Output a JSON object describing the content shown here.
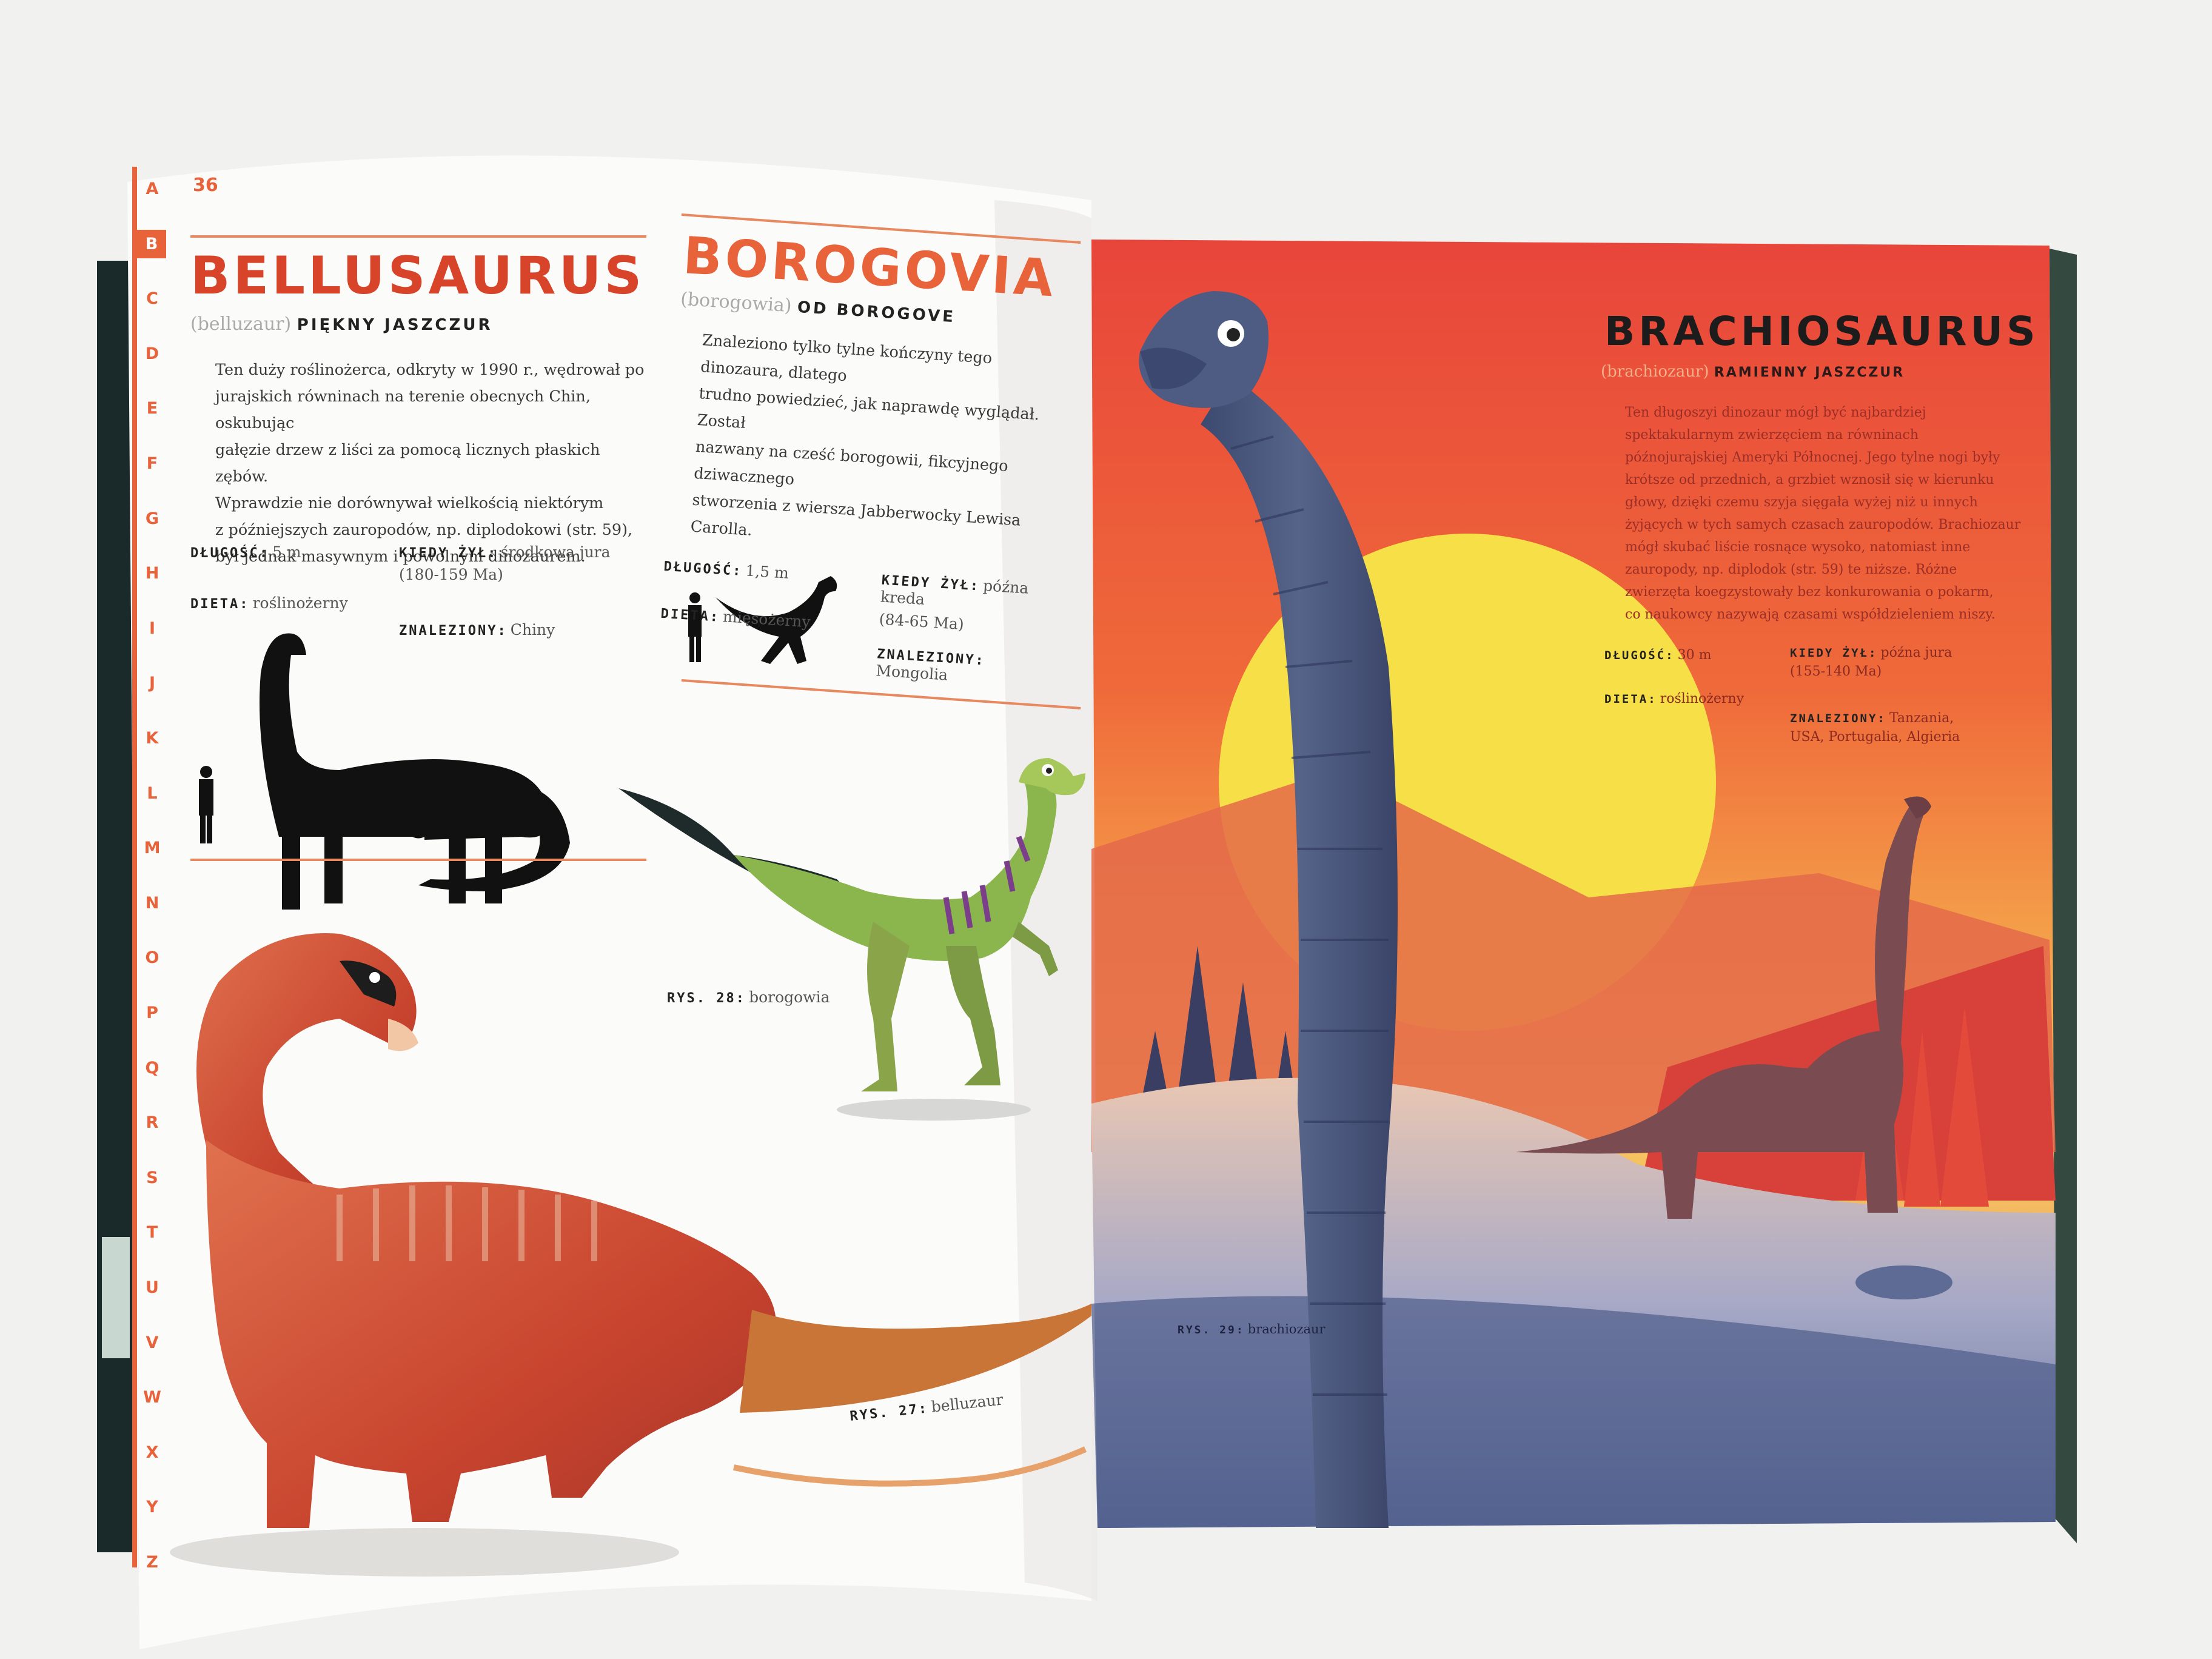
{
  "page_number": "36",
  "alphabet": [
    "A",
    "B",
    "C",
    "D",
    "E",
    "F",
    "G",
    "H",
    "I",
    "J",
    "K",
    "L",
    "M",
    "N",
    "O",
    "P",
    "Q",
    "R",
    "S",
    "T",
    "U",
    "V",
    "W",
    "X",
    "Y",
    "Z"
  ],
  "active_letter": "B",
  "bellusaurus": {
    "title": "BELLUSAURUS",
    "pronunciation": "(belluzaur)",
    "meaning": "PIĘKNY JASZCZUR",
    "body": [
      "Ten duży roślinożerca, odkryty w 1990 r., wędrował po",
      "jurajskich równinach na terenie obecnych Chin, oskubując",
      "gałęzie drzew z liści za pomocą licznych płaskich zębów.",
      "Wprawdzie nie dorównywał wielkością niektórym",
      "z późniejszych zauropodów, np. diplodokowi (str. 59),",
      "był jednak masywnym i powolnym dinozaurem."
    ],
    "length_label": "DŁUGOŚĆ:",
    "length_value": "5 m",
    "when_label": "KIEDY ŻYŁ:",
    "when_value": "środkowa jura",
    "when_range": "(180-159 Ma)",
    "diet_label": "DIETA:",
    "diet_value": "roślinożerny",
    "found_label": "ZNALEZIONY:",
    "found_value": "Chiny",
    "caption_label": "RYS. 27:",
    "caption_value": "belluzaur"
  },
  "borogovia": {
    "title": "BOROGOVIA",
    "pronunciation": "(borogowia)",
    "meaning": "OD BOROGOVE",
    "body": [
      "Znaleziono tylko tylne kończyny tego dinozaura, dlatego",
      "trudno powiedzieć, jak naprawdę wyglądał. Został",
      "nazwany na cześć borogowii, fikcyjnego dziwacznego",
      "stworzenia z wiersza Jabberwocky Lewisa Carolla."
    ],
    "length_label": "DŁUGOŚĆ:",
    "length_value": "1,5 m",
    "when_label": "KIEDY ŻYŁ:",
    "when_value": "późna kreda",
    "when_range": "(84-65 Ma)",
    "diet_label": "DIETA:",
    "diet_value": "mięsożerny",
    "found_label": "ZNALEZIONY:",
    "found_value": "Mongolia",
    "caption_label": "RYS. 28:",
    "caption_value": "borogowia"
  },
  "brachiosaurus": {
    "title": "BRACHIOSAURUS",
    "pronunciation": "(brachiozaur)",
    "meaning": "RAMIENNY JASZCZUR",
    "body": [
      "Ten długoszyi dinozaur mógł być najbardziej",
      "spektakularnym zwierzęciem na równinach",
      "późnojurajskiej Ameryki Północnej. Jego tylne nogi były",
      "krótsze od przednich, a grzbiet wznosił się w kierunku",
      "głowy, dzięki czemu szyja sięgała wyżej niż u innych",
      "żyjących w tych samych czasach zauropodów. Brachiozaur",
      "mógł skubać liście rosnące wysoko, natomiast inne",
      "zauropody, np. diplodok (str. 59) te niższe. Różne",
      "zwierzęta koegzystowały bez konkurowania o pokarm,",
      "co naukowcy nazywają czasami współdzieleniem niszy."
    ],
    "length_label": "DŁUGOŚĆ:",
    "length_value": "30 m",
    "when_label": "KIEDY ŻYŁ:",
    "when_value": "późna jura",
    "when_range": "(155-140 Ma)",
    "diet_label": "DIETA:",
    "diet_value": "roślinożerny",
    "found_label": "ZNALEZIONY:",
    "found_value": "Tanzania,",
    "found_value_2": "USA, Portugalia, Algieria",
    "caption_label": "RYS. 29:",
    "caption_value": "brachiozaur"
  },
  "colors": {
    "accent": "#e8623a",
    "title_red": "#d8442a",
    "brachio_title": "#1c1c1c",
    "sky_top": "#e8533a",
    "sun": "#f7e24a",
    "sauropod_blue": "#4a587e"
  }
}
